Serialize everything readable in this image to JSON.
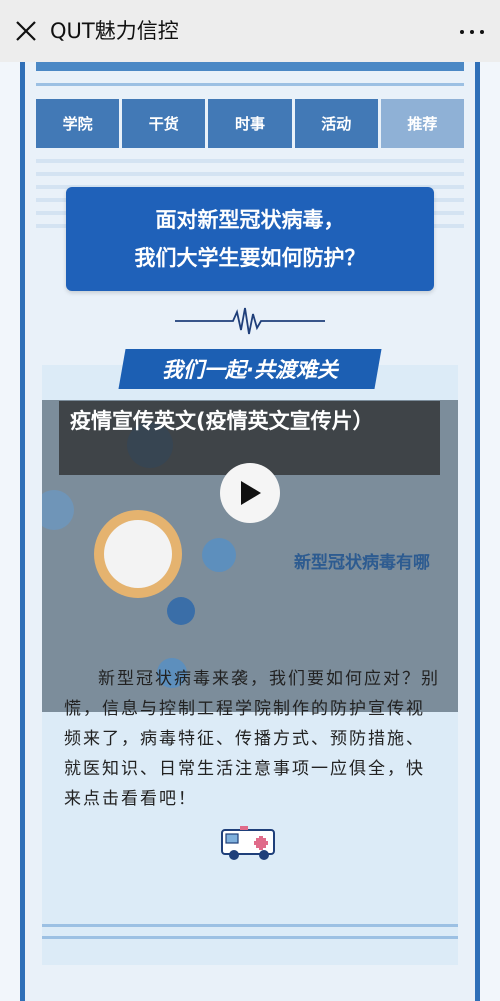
{
  "header": {
    "title": "QUT魅力信控",
    "close_icon": "close-icon",
    "more_icon": "more-dots-icon"
  },
  "article": {
    "tabs": [
      "学院",
      "干货",
      "时事",
      "活动",
      "推荐"
    ],
    "headline_line1": "面对新型冠状病毒，",
    "headline_line2": "我们大学生要如何防护？",
    "slogan": "我们一起·共渡难关",
    "video": {
      "title": "疫情宣传英文(疫情英文宣传片）",
      "caption": "新型冠状病毒有哪",
      "play_icon": "play-icon"
    },
    "body": "新型冠状病毒来袭，我们要如何应对？别慌，信息与控制工程学院制作的防护宣传视频来了，病毒特征、传播方式、预防措施、就医知识、日常生活注意事项一应俱全，快来点击看看吧！"
  },
  "colors": {
    "primary_blue": "#1f61b9",
    "tab_blue": "#4279b6",
    "tab_active": "#8fb1d6",
    "light_bg": "#e9f1f9"
  }
}
